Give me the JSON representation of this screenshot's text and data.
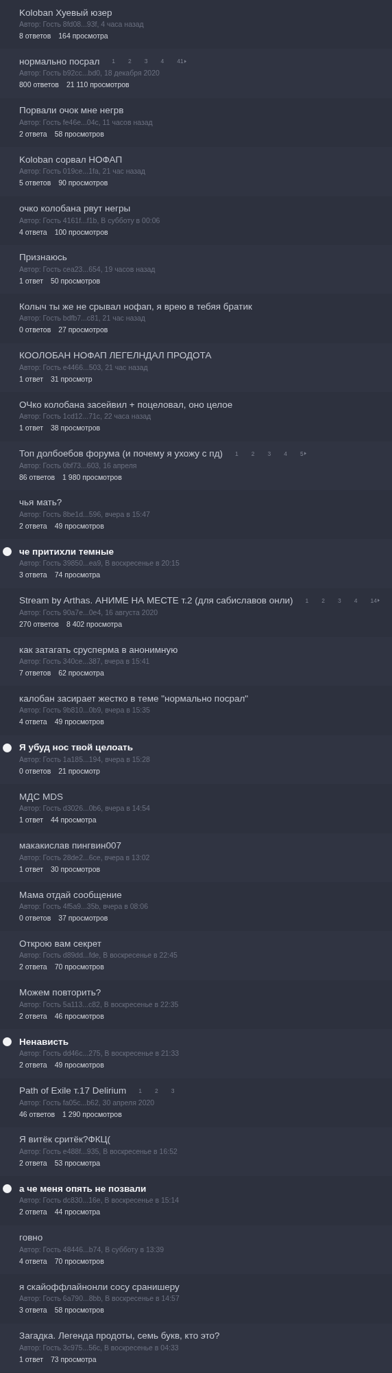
{
  "topics": [
    {
      "title": "Koloban Хуевый юзер",
      "unread": false,
      "author": "Автор: Гость 8fd08...93f, 4 часа назад",
      "replies": "8 ответов",
      "views": "164 просмотра"
    },
    {
      "title": "нормально посрал",
      "unread": false,
      "pages": [
        "1",
        "2",
        "3",
        "4",
        "41"
      ],
      "pages_next": true,
      "author": "Автор: Гость b92cc...bd0, 18 декабря 2020",
      "replies": "800 ответов",
      "views": "21 110 просмотров"
    },
    {
      "title": "Порвали очок мне негрв",
      "unread": false,
      "author": "Автор: Гость fe46e...04c, 11 часов назад",
      "replies": "2 ответа",
      "views": "58 просмотров"
    },
    {
      "title": "Koloban сорвал НОФАП",
      "unread": false,
      "author": "Автор: Гость 019ce...1fa, 21 час назад",
      "replies": "5 ответов",
      "views": "90 просмотров"
    },
    {
      "title": "очко колобана рвут негры",
      "unread": false,
      "author": "Автор: Гость 4161f...f1b, В субботу в 00:06",
      "replies": "4 ответа",
      "views": "100 просмотров"
    },
    {
      "title": "Признаюсь",
      "unread": false,
      "author": "Автор: Гость cea23...654, 19 часов назад",
      "replies": "1 ответ",
      "views": "50 просмотров"
    },
    {
      "title": "Колыч ты же не срывал нофап, я врею в тебяя братик",
      "unread": false,
      "author": "Автор: Гость bdfb7...c81, 21 час назад",
      "replies": "0 ответов",
      "views": "27 просмотров"
    },
    {
      "title": "КООЛОБАН НОФАП ЛЕГЕЛНДАЛ ПРОДОТА",
      "unread": false,
      "author": "Автор: Гость e4466...503, 21 час назад",
      "replies": "1 ответ",
      "views": "31 просмотр"
    },
    {
      "title": "ОЧко колобана засейвил + поцеловал, оно целое",
      "unread": false,
      "author": "Автор: Гость 1cd12...71c, 22 часа назад",
      "replies": "1 ответ",
      "views": "38 просмотров"
    },
    {
      "title": "Топ долбоебов форума (и почему я ухожу с пд)",
      "unread": false,
      "pages": [
        "1",
        "2",
        "3",
        "4",
        "5"
      ],
      "pages_next": true,
      "author": "Автор: Гость 0bf73...603, 16 апреля",
      "replies": "86 ответов",
      "views": "1 980 просмотров"
    },
    {
      "title": "чья мать?",
      "unread": false,
      "author": "Автор: Гость 8be1d...596, вчера в 15:47",
      "replies": "2 ответа",
      "views": "49 просмотров"
    },
    {
      "title": "че притихли темные",
      "unread": true,
      "author": "Автор: Гость 39850...ea9, В воскресенье в 20:15",
      "replies": "3 ответа",
      "views": "74 просмотра"
    },
    {
      "title": "Stream by Arthas. АНИМЕ НА МЕСТЕ т.2 (для сабиславов онли)",
      "unread": false,
      "pages": [
        "1",
        "2",
        "3",
        "4",
        "14"
      ],
      "pages_next": true,
      "author": "Автор: Гость 90a7e...0e4, 16 августа 2020",
      "replies": "270 ответов",
      "views": "8 402 просмотра"
    },
    {
      "title": "как затагать срусперма в анонимную",
      "unread": false,
      "author": "Автор: Гость 340ce...387, вчера в 15:41",
      "replies": "7 ответов",
      "views": "62 просмотра"
    },
    {
      "title": "калобан засирает жестко в теме \"нормально посрал\"",
      "unread": false,
      "author": "Автор: Гость 9b810...0b9, вчера в 15:35",
      "replies": "4 ответа",
      "views": "49 просмотров"
    },
    {
      "title": "Я убуд нос твой целоать",
      "unread": true,
      "author": "Автор: Гость 1a185...194, вчера в 15:28",
      "replies": "0 ответов",
      "views": "21 просмотр"
    },
    {
      "title": "МДС MDS",
      "unread": false,
      "author": "Автор: Гость d3026...0b6, вчера в 14:54",
      "replies": "1 ответ",
      "views": "44 просмотра"
    },
    {
      "title": "макакислав пингвин007",
      "unread": false,
      "author": "Автор: Гость 28de2...6ce, вчера в 13:02",
      "replies": "1 ответ",
      "views": "30 просмотров"
    },
    {
      "title": "Мама отдай сообщение",
      "unread": false,
      "author": "Автор: Гость 4f5a9...35b, вчера в 08:06",
      "replies": "0 ответов",
      "views": "37 просмотров"
    },
    {
      "title": "Открою вам секрет",
      "unread": false,
      "author": "Автор: Гость d89dd...fde, В воскресенье в 22:45",
      "replies": "2 ответа",
      "views": "70 просмотров"
    },
    {
      "title": "Можем повторить?",
      "unread": false,
      "author": "Автор: Гость 5a113...c82, В воскресенье в 22:35",
      "replies": "2 ответа",
      "views": "46 просмотров"
    },
    {
      "title": "Ненависть",
      "unread": true,
      "author": "Автор: Гость dd46c...275, В воскресенье в 21:33",
      "replies": "2 ответа",
      "views": "49 просмотров"
    },
    {
      "title": "Path of Exile т.17 Delirium",
      "unread": false,
      "pages": [
        "1",
        "2",
        "3"
      ],
      "pages_next": false,
      "author": "Автор: Гость fa05c...b62, 30 апреля 2020",
      "replies": "46 ответов",
      "views": "1 290 просмотров"
    },
    {
      "title": "Я витёк сритёк?ФКЦ(",
      "unread": false,
      "author": "Автор: Гость e488f...935, В воскресенье в 16:52",
      "replies": "2 ответа",
      "views": "53 просмотра"
    },
    {
      "title": "а че меня опять не позвали",
      "unread": true,
      "author": "Автор: Гость dc830...16e, В воскресенье в 15:14",
      "replies": "2 ответа",
      "views": "44 просмотра"
    },
    {
      "title": "говно",
      "unread": false,
      "author": "Автор: Гость 48446...b74, В субботу в 13:39",
      "replies": "4 ответа",
      "views": "70 просмотров"
    },
    {
      "title": "я скайоффлайнонли сосу сранишеру",
      "unread": false,
      "author": "Автор: Гость 6a790...8bb, В воскресенье в 14:57",
      "replies": "3 ответа",
      "views": "58 просмотров"
    },
    {
      "title": "Загадка. Легенда продоты, семь букв, кто это?",
      "unread": false,
      "author": "Автор: Гость 3c975...56c, В воскресенье в 04:33",
      "replies": "1 ответ",
      "views": "73 просмотра"
    }
  ]
}
